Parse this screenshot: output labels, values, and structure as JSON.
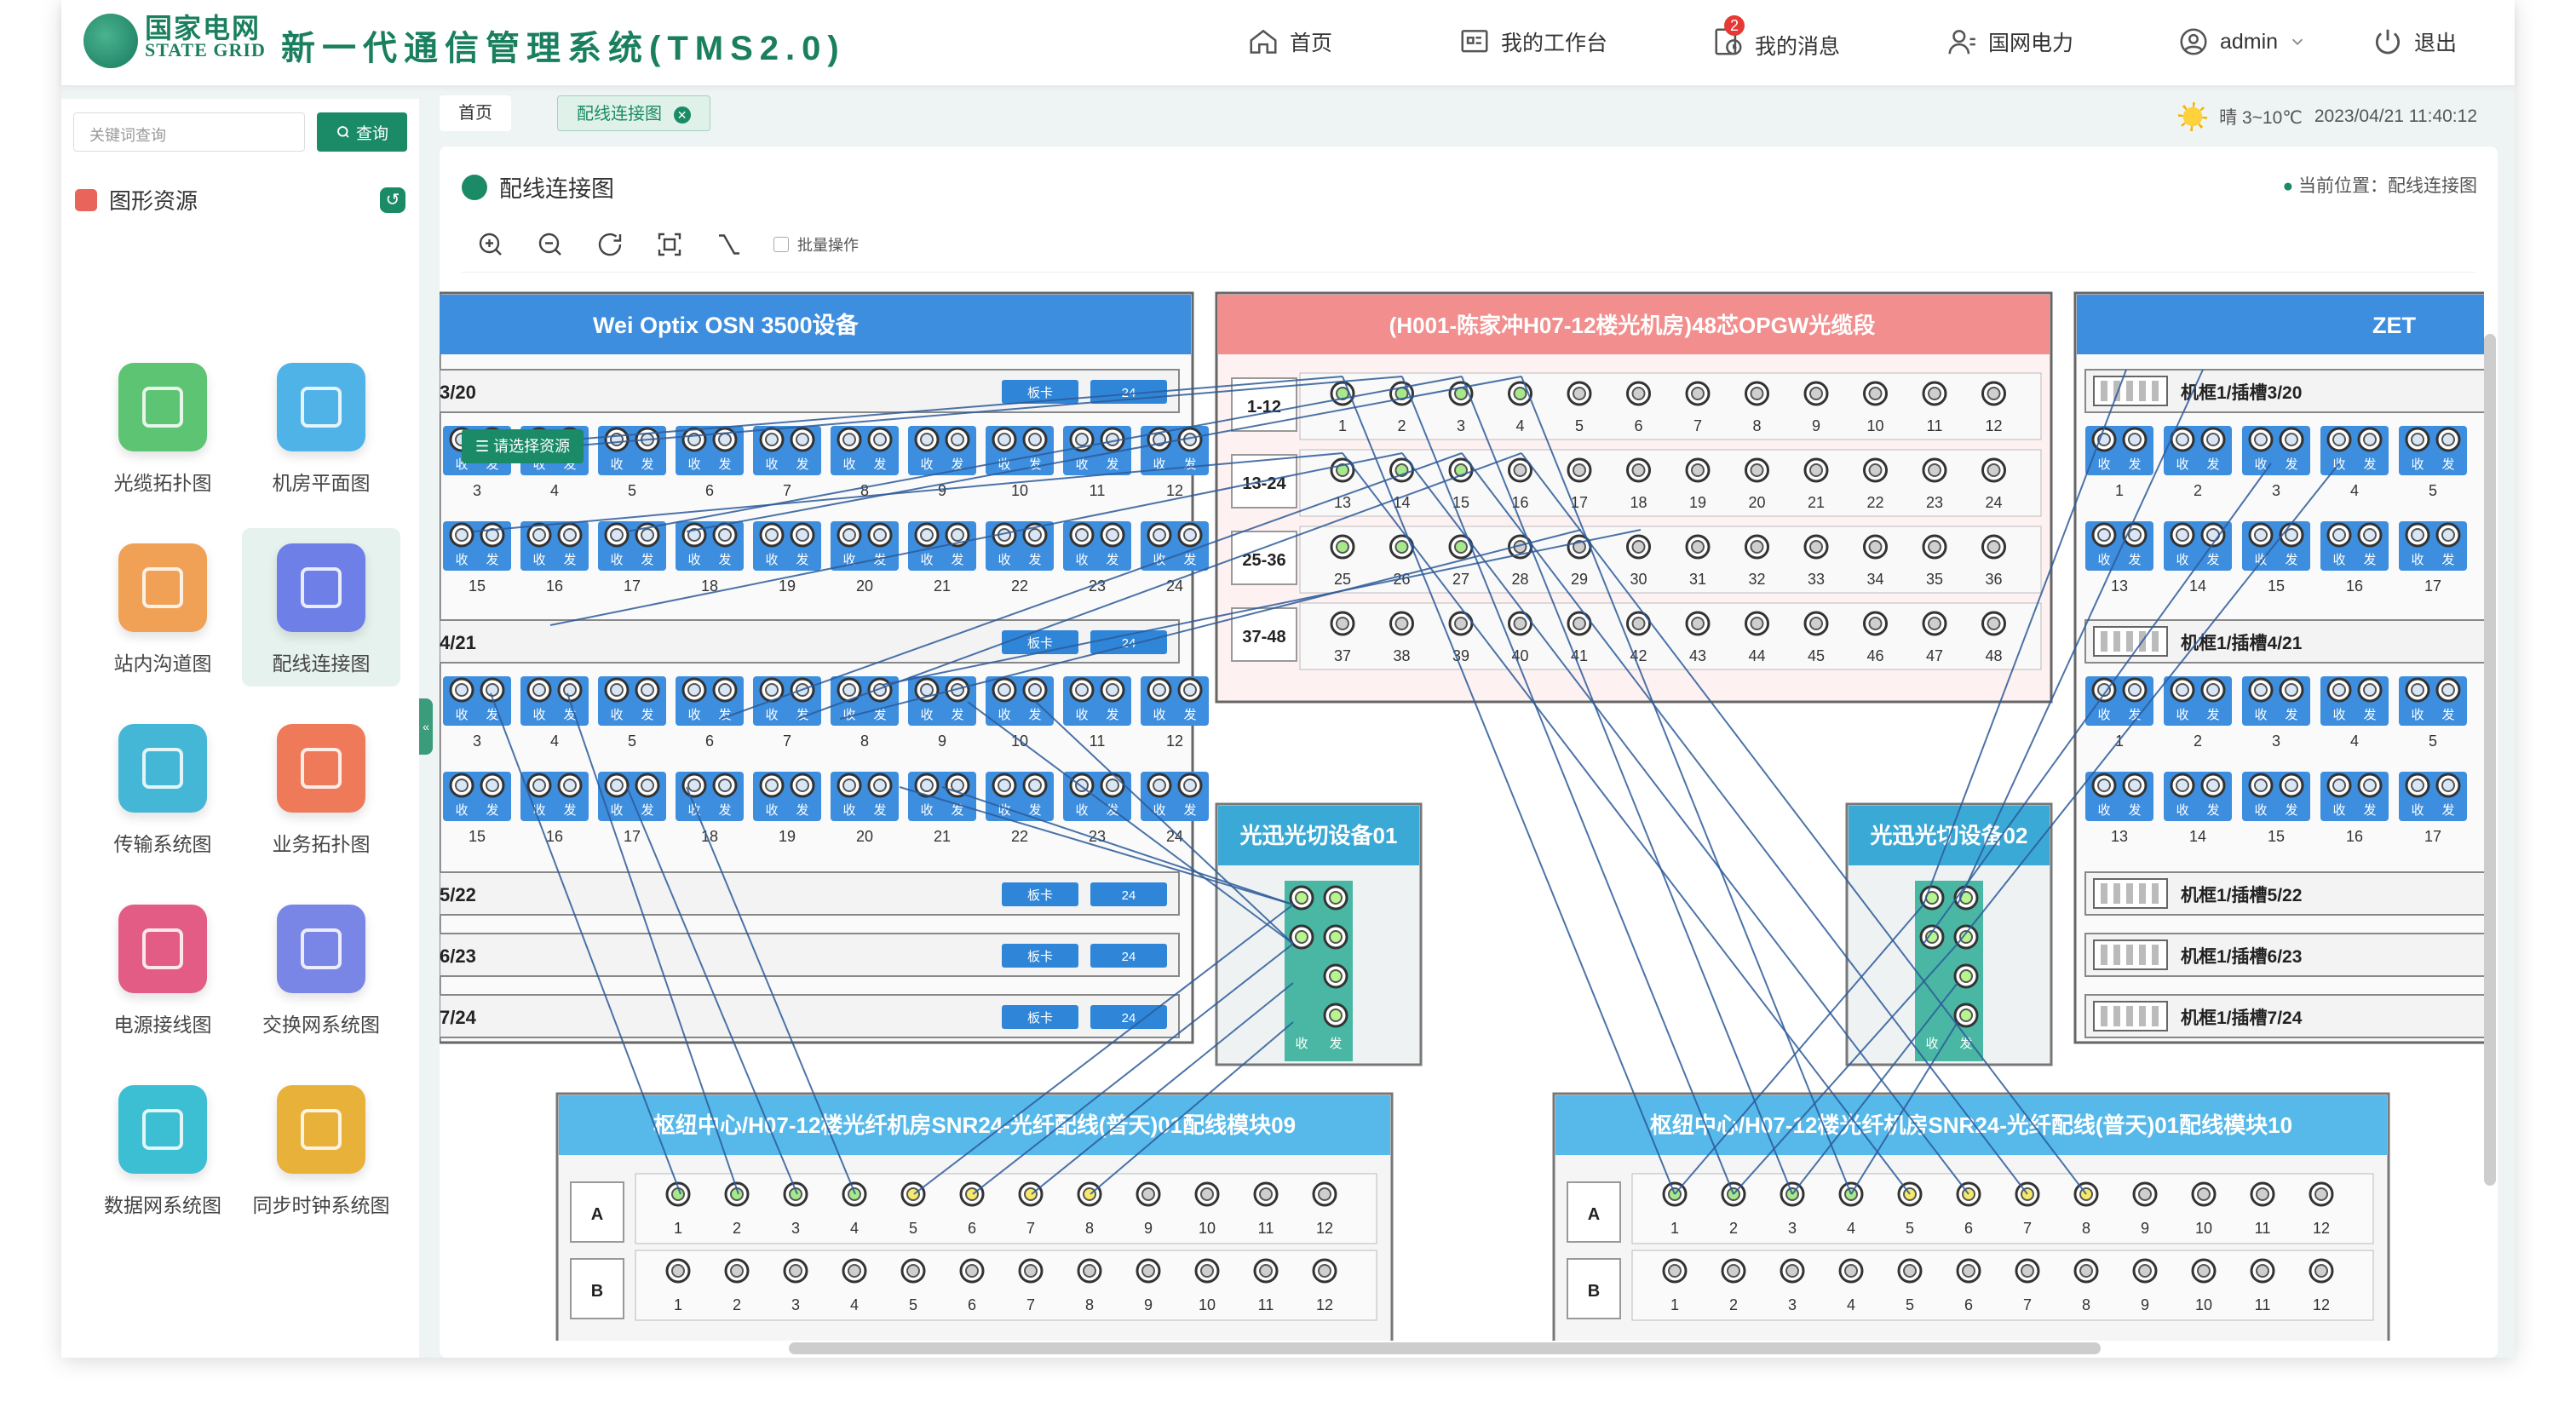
{
  "header": {
    "logo_cn": "国家电网",
    "logo_en": "STATE GRID",
    "title": "新一代通信管理系统(TMS2.0)",
    "nav": [
      {
        "label": "首页",
        "icon": "home-icon"
      },
      {
        "label": "我的工作台",
        "icon": "workbench-icon"
      },
      {
        "label": "我的消息",
        "icon": "message-icon",
        "badge": "2"
      },
      {
        "label": "国网电力",
        "icon": "org-icon"
      },
      {
        "label": "admin",
        "icon": "user-icon"
      },
      {
        "label": "退出",
        "icon": "logout-icon"
      }
    ]
  },
  "sidebar": {
    "search_placeholder": "关键词查询",
    "search_button": "查询",
    "section_title": "图形资源",
    "tiles": [
      {
        "label": "光缆拓扑图",
        "color": "#5cc472"
      },
      {
        "label": "机房平面图",
        "color": "#4fb3e8"
      },
      {
        "label": "站内沟道图",
        "color": "#f0a155"
      },
      {
        "label": "配线连接图",
        "color": "#6f7fe8",
        "active": true
      },
      {
        "label": "传输系统图",
        "color": "#45b7d6"
      },
      {
        "label": "业务拓扑图",
        "color": "#ee7a5a"
      },
      {
        "label": "电源接线图",
        "color": "#e25c86"
      },
      {
        "label": "交换网系统图",
        "color": "#7a86e6"
      },
      {
        "label": "数据网系统图",
        "color": "#3cbfd3"
      },
      {
        "label": "同步时钟系统图",
        "color": "#e8b13a"
      }
    ]
  },
  "tabs": [
    {
      "label": "首页"
    },
    {
      "label": "配线连接图",
      "active": true
    }
  ],
  "weather": {
    "text": "晴 3~10℃",
    "datetime": "2023/04/21 11:40:12"
  },
  "panel": {
    "title": "配线连接图",
    "location": "当前位置：配线连接图",
    "batch_label": "批量操作",
    "select_resource": "请选择资源"
  },
  "diagram": {
    "left_device": {
      "title": "Wei Optix OSN 3500设备",
      "slots": [
        {
          "name": "3/20",
          "expanded": true,
          "tag": "板卡",
          "count": "24"
        },
        {
          "name": "4/21",
          "expanded": true,
          "tag": "板卡",
          "count": "24"
        },
        {
          "name": "5/22",
          "tag": "板卡",
          "count": "24"
        },
        {
          "name": "6/23",
          "tag": "板卡",
          "count": "24"
        },
        {
          "name": "7/24",
          "tag": "板卡",
          "count": "24"
        }
      ],
      "row1_labels": [
        "3",
        "4",
        "5",
        "6",
        "7",
        "8",
        "9",
        "10",
        "11",
        "12"
      ],
      "row2_labels": [
        "15",
        "16",
        "17",
        "18",
        "19",
        "20",
        "21",
        "22",
        "23",
        "24"
      ],
      "port_rx": "收",
      "port_tx": "发"
    },
    "cable": {
      "title": "(H001-陈家冲H07-12楼光机房)48芯OPGW光缆段",
      "rows": [
        "1-12",
        "13-24",
        "25-36",
        "37-48"
      ]
    },
    "right_device": {
      "title": "ZET",
      "slots": [
        {
          "name": "机框1/插槽3/20",
          "expanded": true
        },
        {
          "name": "机框1/插槽4/21",
          "expanded": true
        },
        {
          "name": "机框1/插槽5/22"
        },
        {
          "name": "机框1/插槽6/23"
        },
        {
          "name": "机框1/插槽7/24"
        }
      ],
      "row1_labels": [
        "1",
        "2",
        "3",
        "4",
        "5"
      ],
      "row2_labels": [
        "13",
        "14",
        "15",
        "16",
        "17"
      ]
    },
    "switch1": {
      "title": "光迅光切设备01"
    },
    "switch2": {
      "title": "光迅光切设备02"
    },
    "odf1": {
      "title": "枢纽中心/H07-12楼光纤机房SNR24-光纤配线(普天)01配线模块09",
      "rows": [
        "A",
        "B"
      ]
    },
    "odf2": {
      "title": "枢纽中心/H07-12楼光纤机房SNR24-光纤配线(普天)01配线模块10",
      "rows": [
        "A",
        "B"
      ]
    }
  }
}
